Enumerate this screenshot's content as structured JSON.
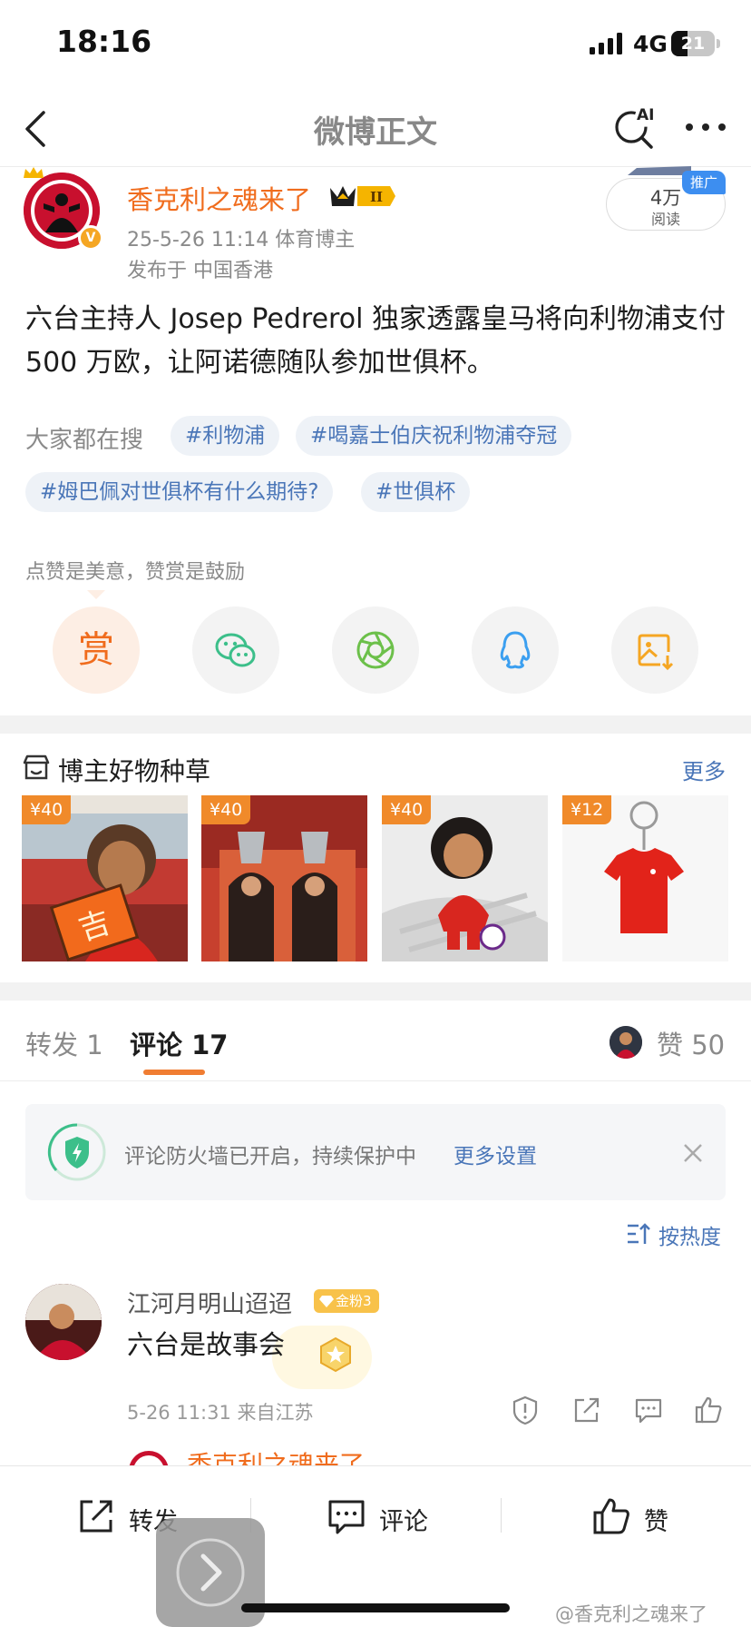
{
  "status_bar": {
    "time": "18:16",
    "network": "4G",
    "battery": "21"
  },
  "nav": {
    "title": "微博正文",
    "ai_label": "AI"
  },
  "post": {
    "author": "香克利之魂来了",
    "vip_level": "II",
    "meta": "25-5-26 11:14  体育博主",
    "location": "发布于 中国香港",
    "read_count": "4万",
    "read_label": "阅读",
    "promo_tag": "推广",
    "text": "六台主持人 Josep Pedrerol 独家透露皇马将向利物浦支付 500 万欧，让阿诺德随队参加世俱杯。"
  },
  "hot_search": {
    "label": "大家都在搜",
    "chips": [
      "#利物浦",
      "#喝嘉士伯庆祝利物浦夺冠",
      "#姆巴佩对世俱杯有什么期待?",
      "#世俱杯"
    ]
  },
  "encourage_text": "点赞是美意，赞赏是鼓励",
  "share_actions": {
    "reward": "赏",
    "icons": [
      "wechat-icon",
      "moments-icon",
      "qq-icon",
      "save-image-icon"
    ]
  },
  "shop": {
    "title": "博主好物种草",
    "more": "更多",
    "products": [
      {
        "price": "¥40",
        "glyph": "吉"
      },
      {
        "price": "¥40"
      },
      {
        "price": "¥40"
      },
      {
        "price": "¥12"
      }
    ]
  },
  "tabs": {
    "repost": "转发 1",
    "comment": "评论 17",
    "likes": "赞 50"
  },
  "firewall": {
    "text": "评论防火墙已开启，持续保护中",
    "link": "更多设置"
  },
  "sort": {
    "label": "按热度"
  },
  "comments": [
    {
      "user": "江河月明山迢迢",
      "badge": "金粉3",
      "text": "六台是故事会",
      "meta": "5-26 11:31  来自江苏"
    }
  ],
  "next_row_preview": "香克利之魂来了",
  "bottom_bar": {
    "repost": "转发",
    "comment": "评论",
    "like": "赞"
  },
  "watermark": "@香克利之魂来了",
  "colors": {
    "accent_orange": "#f06c1d",
    "link_blue": "#4a76b8",
    "liverpool_red": "#c8102e",
    "chip_bg": "#eef2f7"
  }
}
